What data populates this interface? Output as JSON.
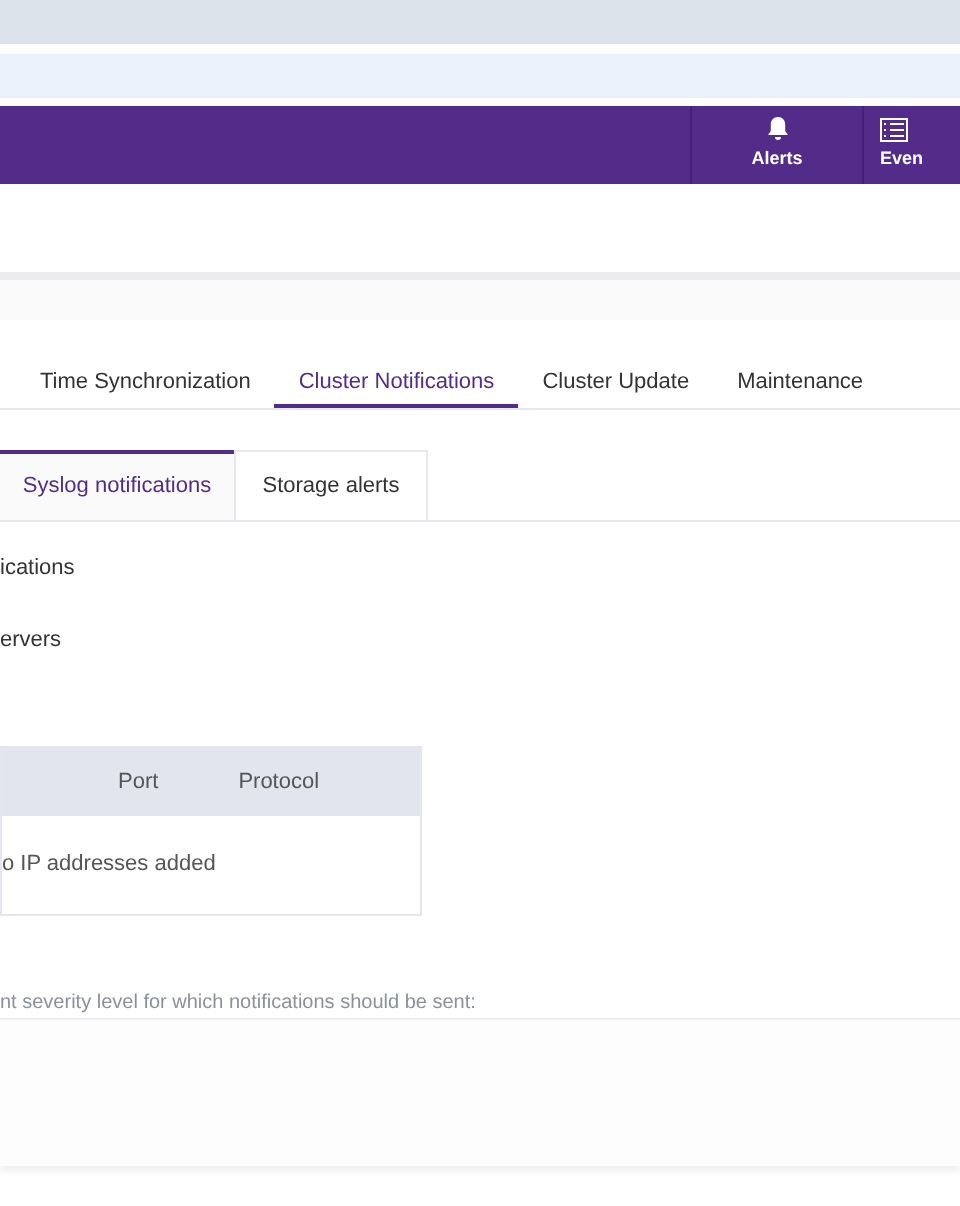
{
  "header": {
    "buttons": [
      {
        "kind": "bell",
        "label": "Alerts"
      },
      {
        "kind": "list",
        "label": "Even"
      }
    ]
  },
  "tabs": [
    {
      "label": "Time Synchronization",
      "selected": false
    },
    {
      "label": "Cluster Notifications",
      "selected": true
    },
    {
      "label": "Cluster Update",
      "selected": false
    },
    {
      "label": "Maintenance",
      "selected": false
    }
  ],
  "subtabs": [
    {
      "label": "Syslog notifications",
      "selected": true
    },
    {
      "label": "Storage alerts",
      "selected": false
    }
  ],
  "section_label": "ications",
  "servers_label": "ervers",
  "table": {
    "columns": [
      "Port",
      "Protocol"
    ],
    "empty_message": "o IP addresses added"
  },
  "severity_text": "nt severity level for which notifications should be sent:"
}
